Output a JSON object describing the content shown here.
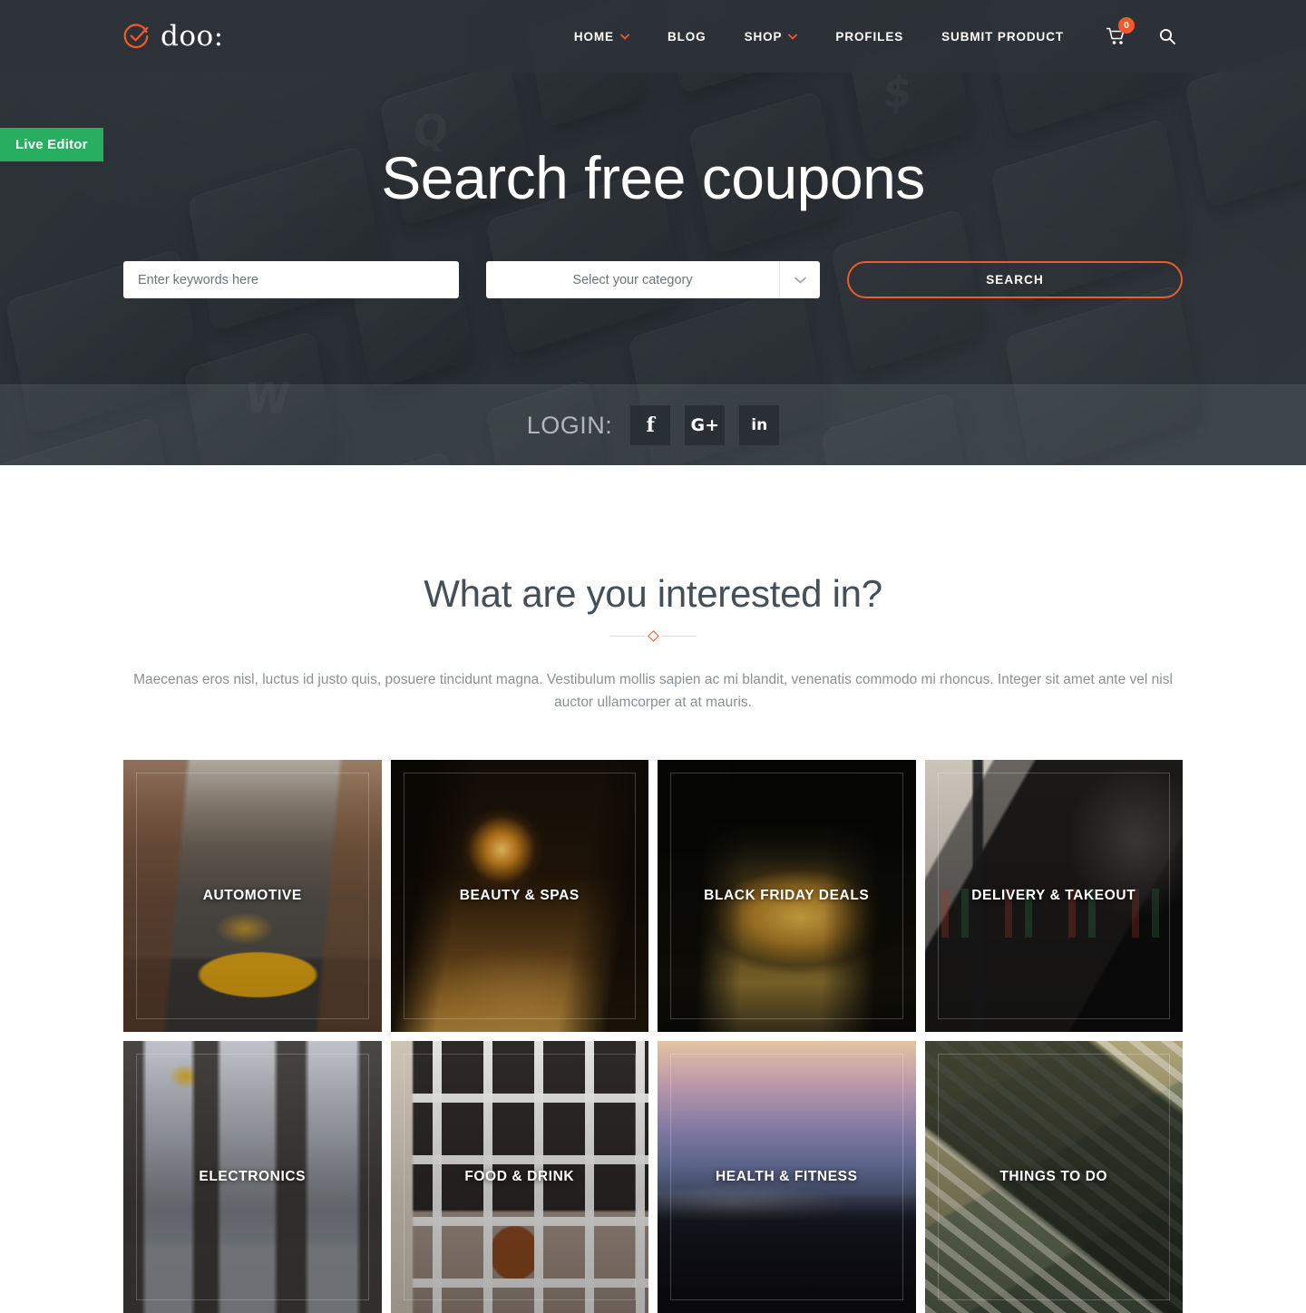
{
  "brand": {
    "name": "doo:",
    "logo_icon": "check-circle-icon",
    "accent": "#f1592a"
  },
  "nav": {
    "items": [
      {
        "label": "HOME",
        "has_dropdown": true
      },
      {
        "label": "BLOG",
        "has_dropdown": false
      },
      {
        "label": "SHOP",
        "has_dropdown": true
      },
      {
        "label": "PROFILES",
        "has_dropdown": false
      },
      {
        "label": "SUBMIT PRODUCT",
        "has_dropdown": false
      }
    ],
    "cart_icon": "shopping-cart-icon",
    "cart_count": "0",
    "search_icon": "search-icon"
  },
  "live_editor": {
    "label": "Live Editor",
    "color": "#27ae60"
  },
  "hero": {
    "title": "Search free coupons",
    "keyword_placeholder": "Enter keywords here",
    "keyword_value": "",
    "category_value": "Select your category",
    "category_caret_icon": "chevron-down-icon",
    "search_button": "SEARCH"
  },
  "login": {
    "label": "LOGIN:",
    "providers": [
      {
        "name": "facebook",
        "glyph": "f",
        "icon": "facebook-icon"
      },
      {
        "name": "google-plus",
        "glyph": "G+",
        "icon": "google-plus-icon"
      },
      {
        "name": "linkedin",
        "glyph": "in",
        "icon": "linkedin-icon"
      }
    ]
  },
  "interest": {
    "title": "What are you interested in?",
    "description": "Maecenas eros nisl, luctus id justo quis, posuere tincidunt magna. Vestibulum mollis sapien ac mi blandit, venenatis commodo mi rhoncus. Integer sit amet ante vel nisl auctor ullamcorper at at mauris.",
    "categories": [
      {
        "label": "AUTOMOTIVE",
        "art": "ph-auto"
      },
      {
        "label": "BEAUTY & SPAS",
        "art": "ph-beauty"
      },
      {
        "label": "BLACK FRIDAY DEALS",
        "art": "ph-blackfri"
      },
      {
        "label": "DELIVERY & TAKEOUT",
        "art": "ph-delivery"
      },
      {
        "label": "ELECTRONICS",
        "art": "ph-electronics"
      },
      {
        "label": "FOOD & DRINK",
        "art": "ph-food"
      },
      {
        "label": "HEALTH & FITNESS",
        "art": "ph-health"
      },
      {
        "label": "THINGS TO DO",
        "art": "ph-things"
      }
    ]
  }
}
